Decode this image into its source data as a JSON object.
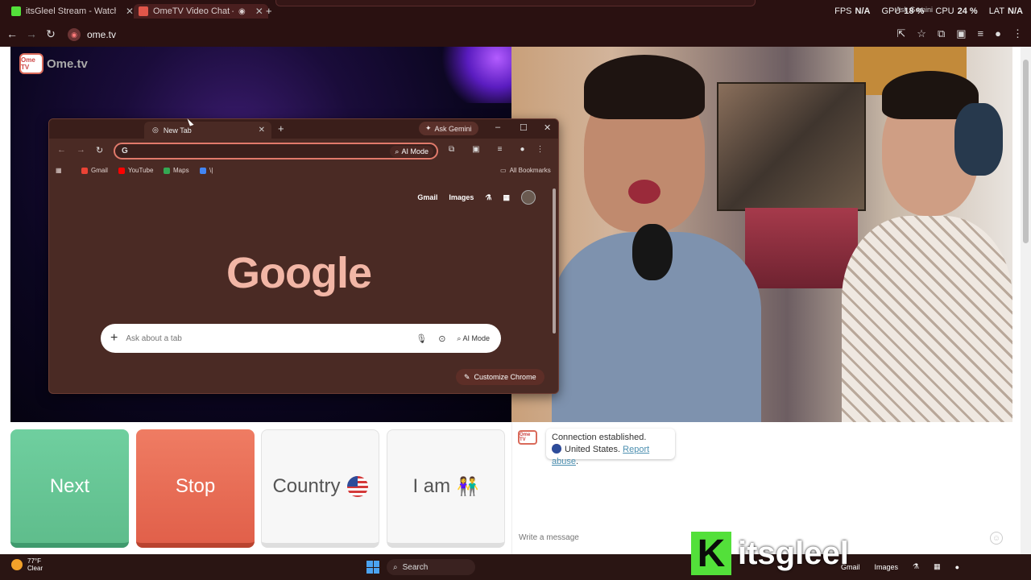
{
  "outer_tabs": [
    {
      "title": "itsGleel Stream - Watch Live on",
      "color": "#53e03a"
    },
    {
      "title": "OmeTV Video Chat — Ome",
      "color": "#e0564a"
    }
  ],
  "perf": {
    "fps_label": "FPS",
    "fps": "N/A",
    "gpu_label": "GPU",
    "gpu": "18 %",
    "cpu_label": "CPU",
    "cpu": "24 %",
    "lat_label": "LAT",
    "lat": "N/A"
  },
  "gemini_mini": "Ask Gemini",
  "address": {
    "url": "ome.tv"
  },
  "left_video": {
    "logo_badge": "Ome TV",
    "logo_text": "Ome.tv"
  },
  "buttons": {
    "next": "Next",
    "stop": "Stop",
    "country": "Country",
    "iam": "I am"
  },
  "chat": {
    "logo": "Ome TV",
    "line1": "Connection established.",
    "country": "United States.",
    "report": "Report abuse",
    "report_suffix": ".",
    "placeholder": "Write a message"
  },
  "window": {
    "tab_title": "New Tab",
    "ask_gemini": "Ask Gemini",
    "omnibox_g": "G",
    "ai_mode": "AI Mode",
    "bookmarks": [
      {
        "label": "Gmail",
        "color": "#ea4335"
      },
      {
        "label": "YouTube",
        "color": "#ff0000"
      },
      {
        "label": "Maps",
        "color": "#34a853"
      },
      {
        "label": "\\|",
        "color": "#4285f4"
      }
    ],
    "all_bookmarks": "All Bookmarks",
    "gmail": "Gmail",
    "images": "Images",
    "logo": "Google",
    "search_placeholder": "Ask about a tab",
    "search_ai_mode": "AI Mode",
    "customize": "Customize Chrome"
  },
  "taskbar": {
    "temp": "77°F",
    "weather": "Clear",
    "search": "Search",
    "gmail": "Gmail",
    "images": "Images"
  },
  "watermark": {
    "k": "K",
    "text": "itsgleel"
  },
  "colors": {
    "accent": "#e07a6b",
    "next_green": "#6fcf9f",
    "stop_red": "#ef7c63",
    "window_bg": "#4a2a24"
  }
}
